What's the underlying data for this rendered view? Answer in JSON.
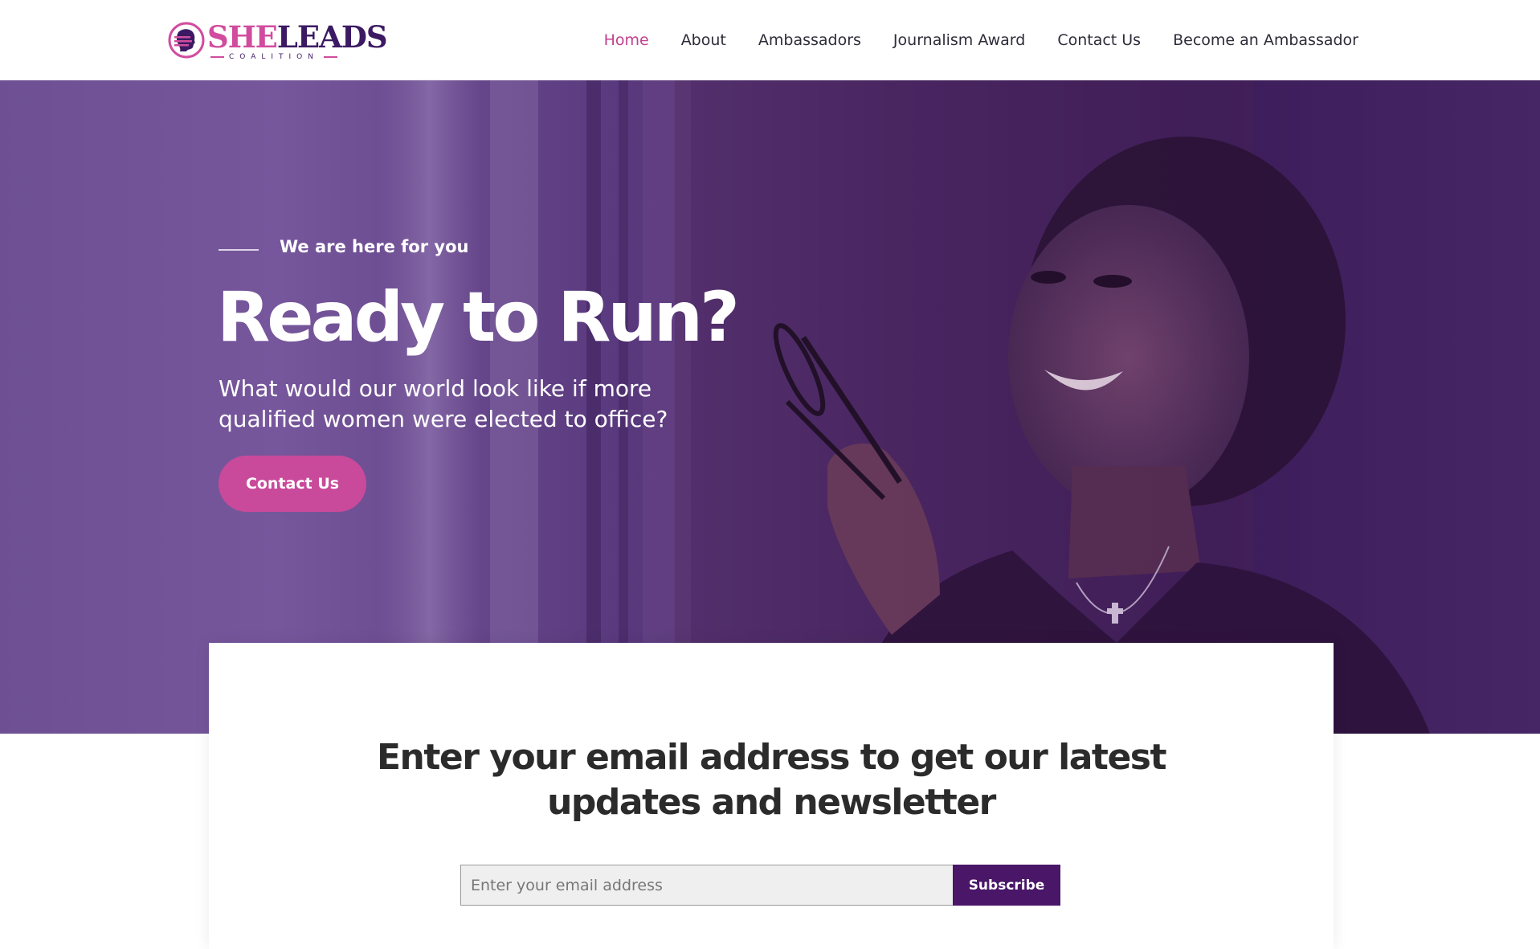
{
  "brand": {
    "name_part1": "SHE",
    "name_part2": "LEADS",
    "tagline": "COALITION"
  },
  "nav": {
    "items": [
      {
        "label": "Home",
        "active": true
      },
      {
        "label": "About",
        "active": false
      },
      {
        "label": "Ambassadors",
        "active": false
      },
      {
        "label": "Journalism Award",
        "active": false
      },
      {
        "label": "Contact Us",
        "active": false
      },
      {
        "label": "Become an Ambassador",
        "active": false
      }
    ]
  },
  "hero": {
    "eyebrow": "We are here for you",
    "title": "Ready to Run?",
    "subtitle": "What would our world look like if more qualified women were elected to office?",
    "cta_label": "Contact Us"
  },
  "newsletter": {
    "heading": "Enter your email address to get our latest updates and newsletter",
    "email_value": "",
    "email_placeholder": "Enter your email address",
    "button_label": "Subscribe"
  },
  "colors": {
    "accent_pink": "#c94a9a",
    "nav_active": "#c2418f",
    "brand_purple": "#4a1668",
    "hero_overlay": "#5a3a7e"
  }
}
